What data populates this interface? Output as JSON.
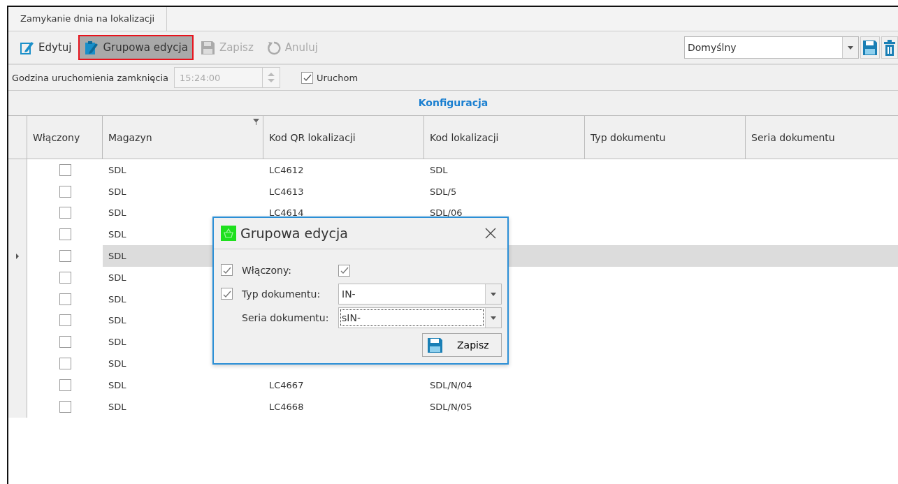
{
  "tabs": [
    {
      "label": "Zamykanie dnia na lokalizacji"
    }
  ],
  "toolbar": {
    "buttons": [
      {
        "label": "Edytuj",
        "kind": "edit",
        "disabled": false,
        "highlighted": false
      },
      {
        "label": "Grupowa edycja",
        "kind": "group",
        "disabled": false,
        "highlighted": true
      },
      {
        "label": "Zapisz",
        "kind": "save",
        "disabled": true,
        "highlighted": false
      },
      {
        "label": "Anuluj",
        "kind": "cancel",
        "disabled": true,
        "highlighted": false
      }
    ],
    "layout_select": {
      "value": "Domyślny"
    }
  },
  "params": {
    "time_label": "Godzina uruchomienia zamknięcia",
    "time_value": "15:24:00",
    "time_disabled": true,
    "run_label": "Uruchom",
    "run_checked": true
  },
  "table": {
    "group_header": "Konfiguracja",
    "columns": [
      "Włączony",
      "Magazyn",
      "Kod QR lokalizacji",
      "Kod lokalizacji",
      "Typ dokumentu",
      "Seria dokumentu"
    ],
    "rows": [
      {
        "checked": false,
        "magazyn": "SDL",
        "qr": "LC4612",
        "kod": "SDL",
        "selected": false
      },
      {
        "checked": false,
        "magazyn": "SDL",
        "qr": "LC4613",
        "kod": "SDL/5",
        "selected": false
      },
      {
        "checked": false,
        "magazyn": "SDL",
        "qr": "LC4614",
        "kod": "SDL/06",
        "selected": false
      },
      {
        "checked": false,
        "magazyn": "SDL",
        "selected": false
      },
      {
        "checked": false,
        "magazyn": "SDL",
        "selected": true
      },
      {
        "checked": false,
        "magazyn": "SDL",
        "selected": false
      },
      {
        "checked": false,
        "magazyn": "SDL",
        "selected": false
      },
      {
        "checked": false,
        "magazyn": "SDL",
        "selected": false
      },
      {
        "checked": false,
        "magazyn": "SDL",
        "selected": false
      },
      {
        "checked": false,
        "magazyn": "SDL",
        "selected": false
      },
      {
        "checked": false,
        "magazyn": "SDL",
        "qr": "LC4667",
        "kod": "SDL/N/04",
        "selected": false
      },
      {
        "checked": false,
        "magazyn": "SDL",
        "qr": "LC4668",
        "kod": "SDL/N/05",
        "selected": false
      }
    ]
  },
  "dialog": {
    "title": "Grupowa edycja",
    "fields": [
      {
        "kind": "checkbox",
        "apply": true,
        "label": "Włączony:",
        "checked": true
      },
      {
        "kind": "combo",
        "apply": true,
        "label": "Typ dokumentu:",
        "value": "IN-",
        "focused": false
      },
      {
        "kind": "combo",
        "label": "Seria dokumentu:",
        "value": "sIN-",
        "focused": true
      }
    ],
    "save_button": "Zapisz"
  }
}
